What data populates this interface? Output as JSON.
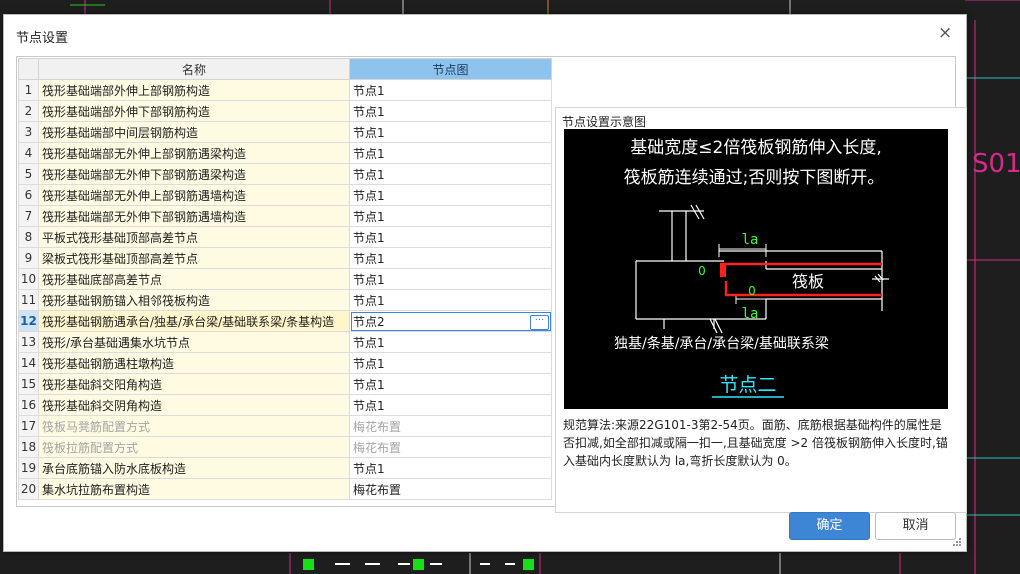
{
  "background": {
    "color": "#1e1e1e",
    "cad_label": "S01"
  },
  "dialog": {
    "title": "节点设置",
    "close_glyph": "×"
  },
  "grid": {
    "headers": {
      "num": "",
      "name": "名称",
      "value": "节点图"
    },
    "rows": [
      {
        "num": "1",
        "name": "筏形基础端部外伸上部钢筋构造",
        "value": "节点1"
      },
      {
        "num": "2",
        "name": "筏形基础端部外伸下部钢筋构造",
        "value": "节点1"
      },
      {
        "num": "3",
        "name": "筏形基础端部中间层钢筋构造",
        "value": "节点1"
      },
      {
        "num": "4",
        "name": "筏形基础端部无外伸上部钢筋遇梁构造",
        "value": "节点1"
      },
      {
        "num": "5",
        "name": "筏形基础端部无外伸下部钢筋遇梁构造",
        "value": "节点1"
      },
      {
        "num": "6",
        "name": "筏形基础端部无外伸上部钢筋遇墙构造",
        "value": "节点1"
      },
      {
        "num": "7",
        "name": "筏形基础端部无外伸下部钢筋遇墙构造",
        "value": "节点1"
      },
      {
        "num": "8",
        "name": "平板式筏形基础顶部高差节点",
        "value": "节点1"
      },
      {
        "num": "9",
        "name": "梁板式筏形基础顶部高差节点",
        "value": "节点1"
      },
      {
        "num": "10",
        "name": "筏形基础底部高差节点",
        "value": "节点1"
      },
      {
        "num": "11",
        "name": "筏形基础钢筋锚入相邻筏板构造",
        "value": "节点1"
      },
      {
        "num": "12",
        "name": "筏形基础钢筋遇承台/独基/承台梁/基础联系梁/条基构造",
        "value": "节点2"
      },
      {
        "num": "13",
        "name": "筏形/承台基础遇集水坑节点",
        "value": "节点1"
      },
      {
        "num": "14",
        "name": "筏形基础钢筋遇柱墩构造",
        "value": "节点1"
      },
      {
        "num": "15",
        "name": "筏形基础斜交阳角构造",
        "value": "节点1"
      },
      {
        "num": "16",
        "name": "筏形基础斜交阴角构造",
        "value": "节点1"
      },
      {
        "num": "17",
        "name": "筏板马凳筋配置方式",
        "value": "梅花布置"
      },
      {
        "num": "18",
        "name": "筏板拉筋配置方式",
        "value": "梅花布置"
      },
      {
        "num": "19",
        "name": "承台底筋锚入防水底板构造",
        "value": "节点1"
      },
      {
        "num": "20",
        "name": "集水坑拉筋布置构造",
        "value": "梅花布置"
      }
    ],
    "selected_row": "12",
    "disabled_rows": [
      "17",
      "18"
    ],
    "ellipsis_label": "···"
  },
  "preview": {
    "title": "节点设置示意图",
    "diagram": {
      "line1": "基础宽度≤2倍筏板钢筋伸入长度,",
      "line2": "筏板筋连续通过;否则按下图断开。",
      "la_top": "la",
      "la_bottom": "la",
      "slab_label": "筏板",
      "foundation_label": "独基/条基/承台/承台梁/基础联系梁",
      "node_name": "节点二",
      "zero_top": "0",
      "zero_bottom": "0"
    },
    "description": "规范算法:来源22G101-3第2-54页。面筋、底筋根据基础构件的属性是否扣减,如全部扣减或隔一扣一,且基础宽度 >2 倍筏板钢筋伸入长度时,锚入基础内长度默认为 la,弯折长度默认为 0。"
  },
  "buttons": {
    "ok": "确定",
    "cancel": "取消"
  },
  "colors": {
    "accent": "#3d86d6",
    "header_selected": "#8ec3ee",
    "name_cell": "#fffbe3",
    "diagram_bg": "#000000",
    "rebar_red": "#ff2020",
    "label_green": "#30ff30",
    "node_cyan": "#2fe6ff"
  }
}
